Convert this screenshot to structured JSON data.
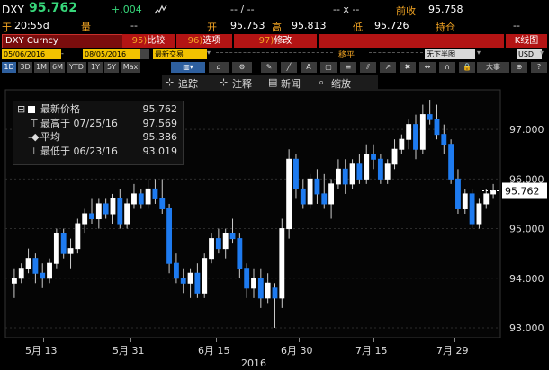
{
  "header": {
    "ticker": "DXY",
    "price": "95.762",
    "change": "+.004",
    "mid_dash": "-- / --",
    "mult": "-- x --",
    "prevclose_label": "前收",
    "prevclose_value": "95.758",
    "time_label": "于",
    "time_value": "20:55d",
    "volume_label": "量",
    "volume_value": "--",
    "open_label": "开",
    "open_value": "95.753",
    "high_label": "高",
    "high_value": "95.813",
    "low_label": "低",
    "low_value": "95.726",
    "position_label": "持仓",
    "position_value": "--"
  },
  "bar": {
    "security": "DXY Curncy",
    "btn1_num": "95)",
    "btn1_label": "比较",
    "btn2_num": "96)",
    "btn2_label": "选项",
    "btn3_num": "97)",
    "btn3_label": "修改",
    "right_label": "K线图"
  },
  "controls": {
    "date_from": "05/06/2016",
    "date_to": "08/05/2016",
    "latest_trades": "最新交易",
    "shift_label": "移平",
    "nobar_label": "无下半图",
    "currency": "USD",
    "periods": [
      "1D",
      "3D",
      "1M",
      "6M",
      "YTD",
      "1Y",
      "5Y",
      "Max"
    ],
    "selected_period": "1D",
    "big_label": "大事"
  },
  "toolbar": {
    "track_label": "追踪",
    "note_label": "注释",
    "news_label": "新闻",
    "zoom_label": "缩放"
  },
  "legend": {
    "last_label": "最新价格",
    "last_value": "95.762",
    "high_label": "最高于 07/25/16",
    "high_value": "97.569",
    "avg_label": "平均",
    "avg_value": "95.386",
    "low_label": "最低于 06/23/16",
    "low_value": "93.019"
  },
  "chart_data": {
    "type": "candlestick",
    "ylim": [
      92.8,
      97.8
    ],
    "yticks": [
      "97.000",
      "96.000",
      "95.000",
      "94.000",
      "93.000"
    ],
    "current_label": "95.762",
    "xticks": [
      "5月 13",
      "5月 31",
      "6月 15",
      "6月 30",
      "7月 15",
      "7月 29"
    ],
    "year_label": "2016",
    "candles": [
      [
        93.9,
        94.2,
        93.6,
        94.0
      ],
      [
        94.0,
        94.3,
        93.9,
        94.2
      ],
      [
        94.2,
        94.6,
        94.1,
        94.4
      ],
      [
        94.4,
        94.5,
        93.9,
        94.1
      ],
      [
        94.1,
        94.3,
        93.8,
        94.0
      ],
      [
        94.0,
        94.4,
        93.9,
        94.3
      ],
      [
        94.3,
        95.0,
        94.2,
        94.9
      ],
      [
        94.9,
        95.0,
        94.4,
        94.5
      ],
      [
        94.5,
        94.8,
        94.2,
        94.6
      ],
      [
        94.6,
        95.2,
        94.5,
        95.1
      ],
      [
        95.1,
        95.4,
        94.9,
        95.3
      ],
      [
        95.3,
        95.6,
        95.1,
        95.2
      ],
      [
        95.2,
        95.6,
        95.0,
        95.5
      ],
      [
        95.5,
        95.6,
        95.2,
        95.3
      ],
      [
        95.3,
        95.7,
        95.1,
        95.6
      ],
      [
        95.6,
        95.8,
        95.0,
        95.1
      ],
      [
        95.1,
        95.6,
        95.0,
        95.5
      ],
      [
        95.5,
        95.9,
        95.4,
        95.7
      ],
      [
        95.7,
        95.8,
        95.4,
        95.5
      ],
      [
        95.5,
        96.0,
        95.4,
        95.8
      ],
      [
        95.8,
        96.0,
        95.5,
        95.6
      ],
      [
        95.6,
        96.0,
        95.3,
        95.4
      ],
      [
        95.4,
        95.5,
        94.1,
        94.3
      ],
      [
        94.3,
        94.5,
        93.9,
        94.0
      ],
      [
        94.0,
        94.2,
        93.7,
        93.9
      ],
      [
        93.9,
        94.2,
        93.6,
        94.1
      ],
      [
        94.1,
        94.3,
        93.6,
        93.7
      ],
      [
        93.7,
        94.5,
        93.6,
        94.4
      ],
      [
        94.4,
        94.9,
        94.3,
        94.8
      ],
      [
        94.8,
        95.0,
        94.5,
        94.6
      ],
      [
        94.6,
        95.0,
        94.4,
        94.9
      ],
      [
        94.9,
        95.2,
        94.7,
        94.8
      ],
      [
        94.8,
        94.9,
        94.0,
        94.2
      ],
      [
        94.2,
        94.3,
        93.6,
        93.8
      ],
      [
        93.8,
        94.2,
        93.6,
        94.0
      ],
      [
        94.0,
        94.2,
        93.4,
        93.6
      ],
      [
        93.6,
        94.1,
        93.5,
        93.9
      ],
      [
        93.8,
        93.9,
        93.0,
        93.6
      ],
      [
        93.6,
        95.2,
        93.4,
        95.0
      ],
      [
        95.0,
        96.6,
        94.8,
        96.4
      ],
      [
        96.4,
        96.5,
        95.6,
        95.8
      ],
      [
        95.8,
        96.0,
        95.4,
        95.5
      ],
      [
        95.5,
        96.1,
        95.4,
        96.0
      ],
      [
        96.0,
        96.2,
        95.5,
        95.7
      ],
      [
        95.7,
        96.1,
        95.4,
        95.5
      ],
      [
        95.5,
        96.0,
        95.2,
        95.9
      ],
      [
        95.9,
        96.4,
        95.8,
        96.2
      ],
      [
        96.2,
        96.4,
        95.7,
        95.9
      ],
      [
        95.9,
        96.4,
        95.8,
        96.3
      ],
      [
        96.3,
        96.5,
        95.9,
        96.0
      ],
      [
        96.0,
        96.7,
        95.9,
        96.5
      ],
      [
        96.5,
        96.7,
        96.2,
        96.4
      ],
      [
        96.4,
        96.5,
        95.9,
        96.0
      ],
      [
        96.0,
        96.4,
        95.9,
        96.3
      ],
      [
        96.3,
        96.8,
        96.2,
        96.6
      ],
      [
        96.6,
        96.9,
        96.5,
        96.8
      ],
      [
        96.8,
        97.2,
        96.6,
        97.1
      ],
      [
        97.1,
        97.3,
        96.4,
        96.6
      ],
      [
        96.6,
        97.5,
        96.5,
        97.3
      ],
      [
        97.3,
        97.6,
        97.1,
        97.2
      ],
      [
        97.2,
        97.5,
        96.8,
        96.9
      ],
      [
        96.9,
        97.1,
        96.5,
        96.7
      ],
      [
        96.7,
        96.8,
        95.9,
        96.0
      ],
      [
        96.0,
        96.2,
        95.3,
        95.4
      ],
      [
        95.4,
        95.8,
        95.3,
        95.7
      ],
      [
        95.7,
        95.8,
        95.0,
        95.1
      ],
      [
        95.1,
        95.6,
        95.0,
        95.5
      ],
      [
        95.5,
        95.8,
        95.4,
        95.7
      ],
      [
        95.7,
        95.9,
        95.6,
        95.76
      ]
    ],
    "up_color": "#ffffff",
    "down_color": "#1e7bf0"
  }
}
